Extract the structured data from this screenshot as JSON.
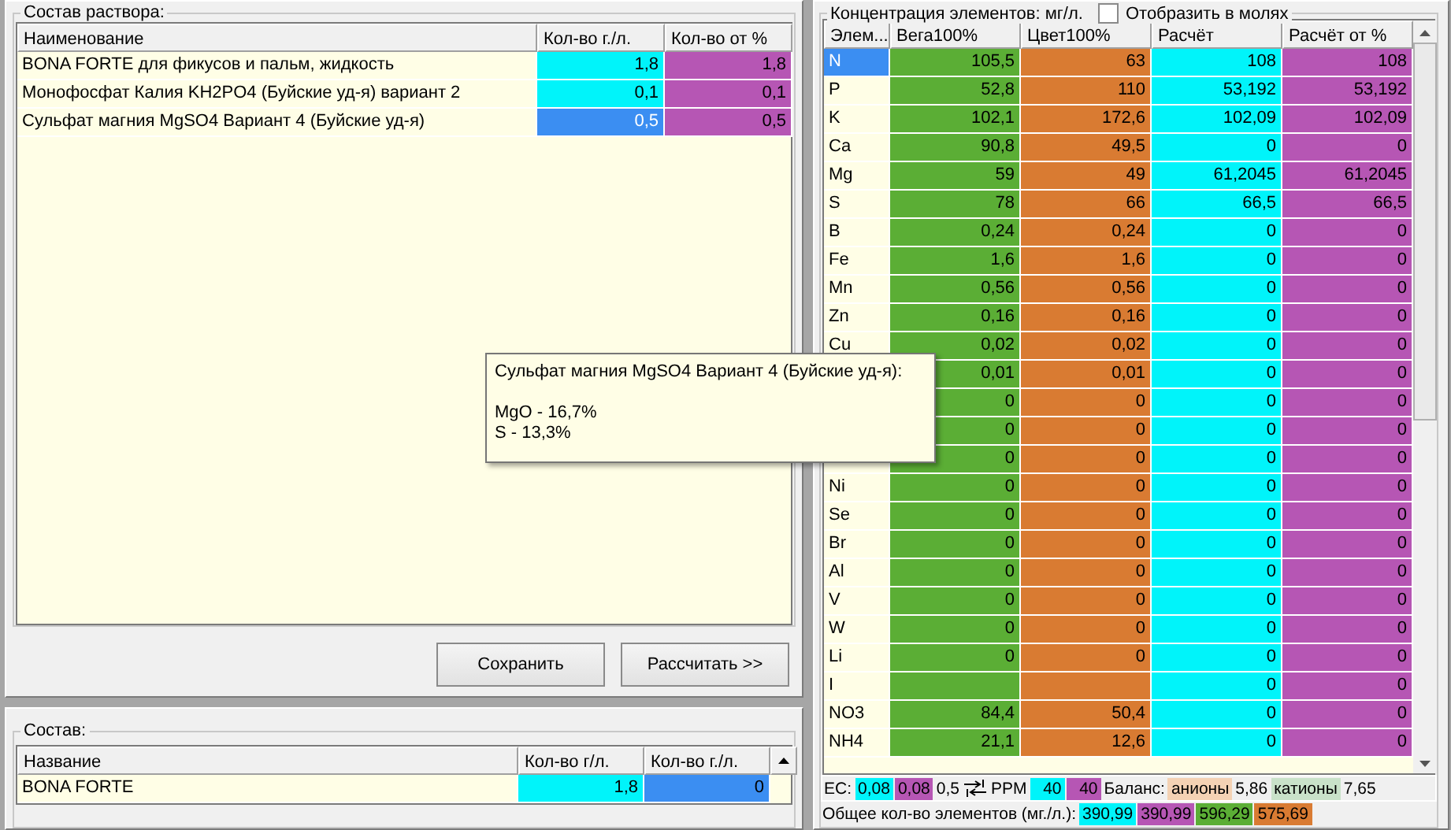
{
  "solution_panel": {
    "title": "Состав раствора:",
    "columns": [
      {
        "label": "Наименование"
      },
      {
        "label": "Кол-во г./л.",
        "color": "#00f4fa"
      },
      {
        "label": "Кол-во от %",
        "color": "#b656b4"
      }
    ],
    "rows": [
      {
        "name": "BONA FORTE для фикусов и пальм, жидкость",
        "amount": "1,8",
        "percent": "1,8",
        "selected": false
      },
      {
        "name": "Монофосфат Калия KH2PO4 (Буйские уд-я) вариант 2",
        "amount": "0,1",
        "percent": "0,1",
        "selected": false
      },
      {
        "name": "Сульфат магния MgSO4 Вариант 4 (Буйские уд-я)",
        "amount": "0,5",
        "percent": "0,5",
        "selected": true
      }
    ],
    "buttons": [
      "Сохранить",
      "Рассчитать >>"
    ]
  },
  "composition_panel": {
    "title": "Состав:",
    "columns": [
      "Название",
      "Кол-во г/л.",
      "Кол-во г./л."
    ],
    "rows": [
      {
        "name": "BONA FORTE",
        "values": [
          "1,8",
          "0"
        ]
      }
    ]
  },
  "concentration_panel": {
    "title": "Концентрация элементов: мг/л.",
    "moles_checkbox": {
      "label": "Отобразить в молях",
      "checked": false
    },
    "columns": [
      {
        "label": "Элем..."
      },
      {
        "label": "Вега100%",
        "color": "#5bae35"
      },
      {
        "label": "Цвет100%",
        "color": "#d97b32"
      },
      {
        "label": "Расчёт",
        "color": "#00f4fa"
      },
      {
        "label": "Расчёт от %",
        "color": "#b656b4"
      }
    ],
    "rows": [
      {
        "element": "N",
        "selected": true,
        "values": [
          "105,5",
          "63",
          "108",
          "108"
        ]
      },
      {
        "element": "P",
        "selected": false,
        "values": [
          "52,8",
          "110",
          "53,192",
          "53,192"
        ]
      },
      {
        "element": "K",
        "selected": false,
        "values": [
          "102,1",
          "172,6",
          "102,09",
          "102,09"
        ]
      },
      {
        "element": "Ca",
        "selected": false,
        "values": [
          "90,8",
          "49,5",
          "0",
          "0"
        ]
      },
      {
        "element": "Mg",
        "selected": false,
        "values": [
          "59",
          "49",
          "61,2045",
          "61,2045"
        ]
      },
      {
        "element": "S",
        "selected": false,
        "values": [
          "78",
          "66",
          "66,5",
          "66,5"
        ]
      },
      {
        "element": "B",
        "selected": false,
        "values": [
          "0,24",
          "0,24",
          "0",
          "0"
        ]
      },
      {
        "element": "Fe",
        "selected": false,
        "values": [
          "1,6",
          "1,6",
          "0",
          "0"
        ]
      },
      {
        "element": "Mn",
        "selected": false,
        "values": [
          "0,56",
          "0,56",
          "0",
          "0"
        ]
      },
      {
        "element": "Zn",
        "selected": false,
        "values": [
          "0,16",
          "0,16",
          "0",
          "0"
        ]
      },
      {
        "element": "Cu",
        "selected": false,
        "values": [
          "0,02",
          "0,02",
          "0",
          "0"
        ]
      },
      {
        "values": [
          "0,01",
          "0,01",
          "0",
          "0"
        ]
      },
      {
        "values": [
          "0",
          "0",
          "0",
          "0"
        ]
      },
      {
        "values": [
          "0",
          "0",
          "0",
          "0"
        ]
      },
      {
        "values": [
          "0",
          "0",
          "0",
          "0"
        ]
      },
      {
        "element": "Ni",
        "selected": false,
        "values": [
          "0",
          "0",
          "0",
          "0"
        ]
      },
      {
        "element": "Se",
        "selected": false,
        "values": [
          "0",
          "0",
          "0",
          "0"
        ]
      },
      {
        "element": "Br",
        "selected": false,
        "values": [
          "0",
          "0",
          "0",
          "0"
        ]
      },
      {
        "element": "Al",
        "selected": false,
        "values": [
          "0",
          "0",
          "0",
          "0"
        ]
      },
      {
        "element": "V",
        "selected": false,
        "values": [
          "0",
          "0",
          "0",
          "0"
        ]
      },
      {
        "element": "W",
        "selected": false,
        "values": [
          "0",
          "0",
          "0",
          "0"
        ]
      },
      {
        "element": "Li",
        "selected": false,
        "values": [
          "0",
          "0",
          "0",
          "0"
        ]
      },
      {
        "element": "I",
        "selected": false,
        "values": {
          "calc": "0",
          "calc_percent": "0"
        }
      },
      {
        "element": "NO3",
        "selected": false,
        "values": [
          "84,4",
          "50,4",
          "0",
          "0"
        ]
      },
      {
        "element": "NH4",
        "selected": false,
        "values": [
          "21,1",
          "12,6",
          "0",
          "0"
        ]
      }
    ],
    "ec_bar": [
      {
        "kind": "label",
        "text": "EC:"
      },
      {
        "kind": "value",
        "text": "0,08",
        "color": "#00f4fa"
      },
      {
        "kind": "value",
        "text": "0,08",
        "color": "#b656b4"
      },
      {
        "kind": "label",
        "text": "0,5"
      },
      {
        "kind": "spin"
      },
      {
        "kind": "label",
        "text": "PPM"
      },
      {
        "kind": "value",
        "text": "40",
        "color": "#00f4fa"
      },
      {
        "kind": "value",
        "text": "40",
        "color": "#b656b4"
      },
      {
        "kind": "label",
        "text": "Баланс:"
      },
      {
        "kind": "value",
        "text": "анионы",
        "color": "#f4d2b4"
      },
      {
        "kind": "label",
        "text": "5,86"
      },
      {
        "kind": "value",
        "text": "катионы",
        "color": "#c9e2c9"
      },
      {
        "kind": "label",
        "text": "7,65"
      }
    ],
    "totals_bar": [
      {
        "kind": "label",
        "text": "Общее кол-во элементов (мг./л.):"
      },
      {
        "kind": "value",
        "text": "390,99",
        "color": "#00f4fa"
      },
      {
        "kind": "value",
        "text": "390,99",
        "color": "#b656b4"
      },
      {
        "kind": "value",
        "text": "596,29",
        "color": "#5bae35"
      },
      {
        "kind": "value",
        "text": "575,69",
        "color": "#d97b32"
      }
    ]
  },
  "tooltip": {
    "title": "Сульфат магния MgSO4 Вариант 4 (Буйские уд-я):",
    "lines": [
      "MgO - 16,7%",
      "S - 13,3%"
    ]
  }
}
